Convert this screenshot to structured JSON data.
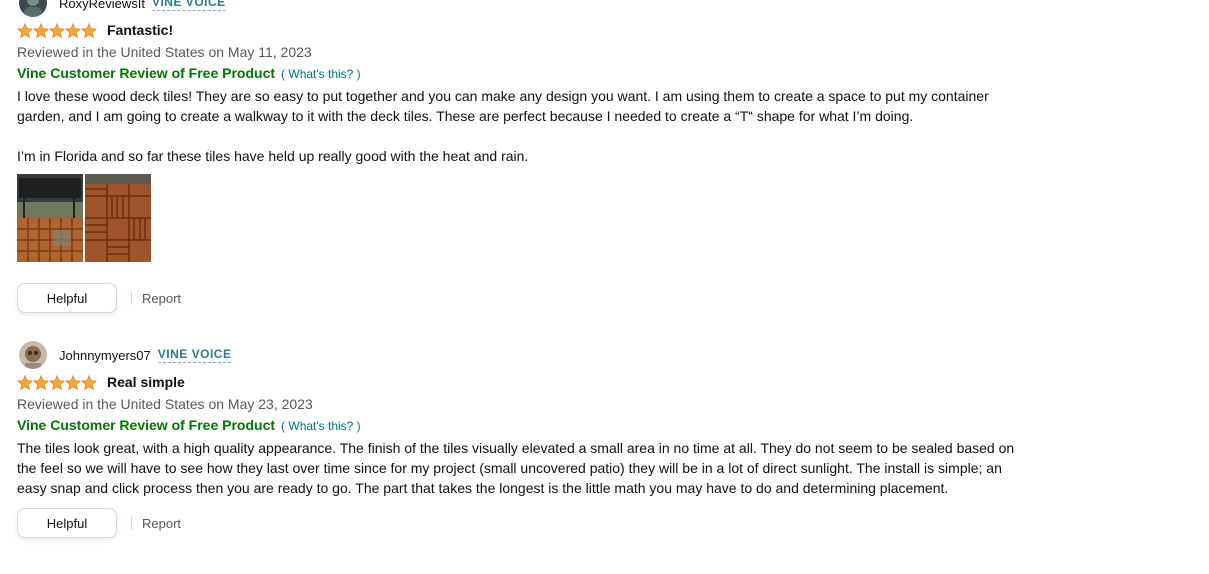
{
  "reviews": [
    {
      "username": "RoxyReviewsIt",
      "badge": "VINE VOICE",
      "rating": 5,
      "title": "Fantastic!",
      "date": "Reviewed in the United States on May 11, 2023",
      "vine_label": "Vine Customer Review of Free Product",
      "whats_this": "( What's this? )",
      "paragraphs": [
        "I love these wood deck tiles! They are so easy to put together and you can make any design you want. I am using them to create a space to put my container garden, and I am going to create a walkway to it with the deck tiles. These are perfect because I needed to create a “T“ shape for what I’m doing.",
        "I’m in Florida and so far these tiles have held up really good with the heat and rain."
      ],
      "helpful_label": "Helpful",
      "report_label": "Report"
    },
    {
      "username": "Johnnymyers07",
      "badge": "VINE VOICE",
      "rating": 5,
      "title": "Real simple",
      "date": "Reviewed in the United States on May 23, 2023",
      "vine_label": "Vine Customer Review of Free Product",
      "whats_this": "( What's this? )",
      "paragraphs": [
        "The tiles look great, with a high quality appearance. The finish of the tiles visually elevated a small area in no time at all. They do not seem to be sealed based on the feel so we will have to see how they last over time since for my project (small uncovered patio) they will be in a lot of direct sunlight. The install is simple; an easy snap and click process then you are ready to go. The part that takes the longest is the little math you may have to do and determining placement."
      ],
      "helpful_label": "Helpful",
      "report_label": "Report"
    }
  ],
  "colors": {
    "star": "#ffa41c",
    "vine_badge": "#2b7b8d",
    "vine_product": "#007600",
    "link": "#007185"
  },
  "icons": [
    "star-icon",
    "avatar"
  ]
}
